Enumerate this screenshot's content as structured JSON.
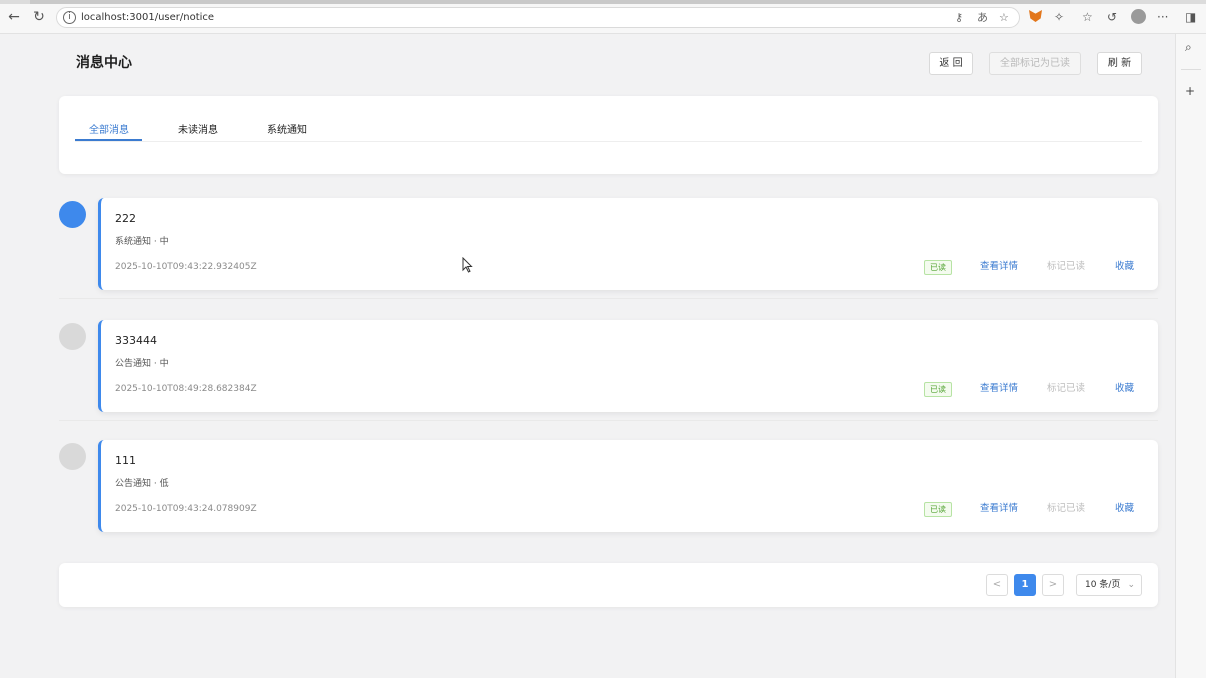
{
  "browser": {
    "url": "localhost:3001/user/notice",
    "back_icon": "arrow-left-icon",
    "reload_icon": "reload-icon",
    "info_icon": "info-icon",
    "more_label": "···"
  },
  "header": {
    "title": "消息中心",
    "back_label": "返 回",
    "mark_all_label": "全部标记为已读",
    "refresh_label": "刷 新"
  },
  "tabs": [
    {
      "label": "全部消息",
      "active": true
    },
    {
      "label": "未读消息",
      "active": false
    },
    {
      "label": "系统通知",
      "active": false
    }
  ],
  "notices": [
    {
      "title": "222",
      "meta": "系统通知 · 中",
      "time": "2025-10-10T09:43:22.932405Z",
      "status": "已读",
      "detail": "查看详情",
      "mark": "标记已读",
      "fav": "收藏",
      "dot": "blue"
    },
    {
      "title": "333444",
      "meta": "公告通知 · 中",
      "time": "2025-10-10T08:49:28.682384Z",
      "status": "已读",
      "detail": "查看详情",
      "mark": "标记已读",
      "fav": "收藏",
      "dot": "gray"
    },
    {
      "title": "111",
      "meta": "公告通知 · 低",
      "time": "2025-10-10T09:43:24.078909Z",
      "status": "已读",
      "detail": "查看详情",
      "mark": "标记已读",
      "fav": "收藏",
      "dot": "gray"
    }
  ],
  "pagination": {
    "prev": "<",
    "current": "1",
    "next": ">",
    "page_size": "10 条/页"
  },
  "colors": {
    "accent": "#3e89ec",
    "link": "#3b7bd0",
    "read_tag": "#52a332"
  }
}
